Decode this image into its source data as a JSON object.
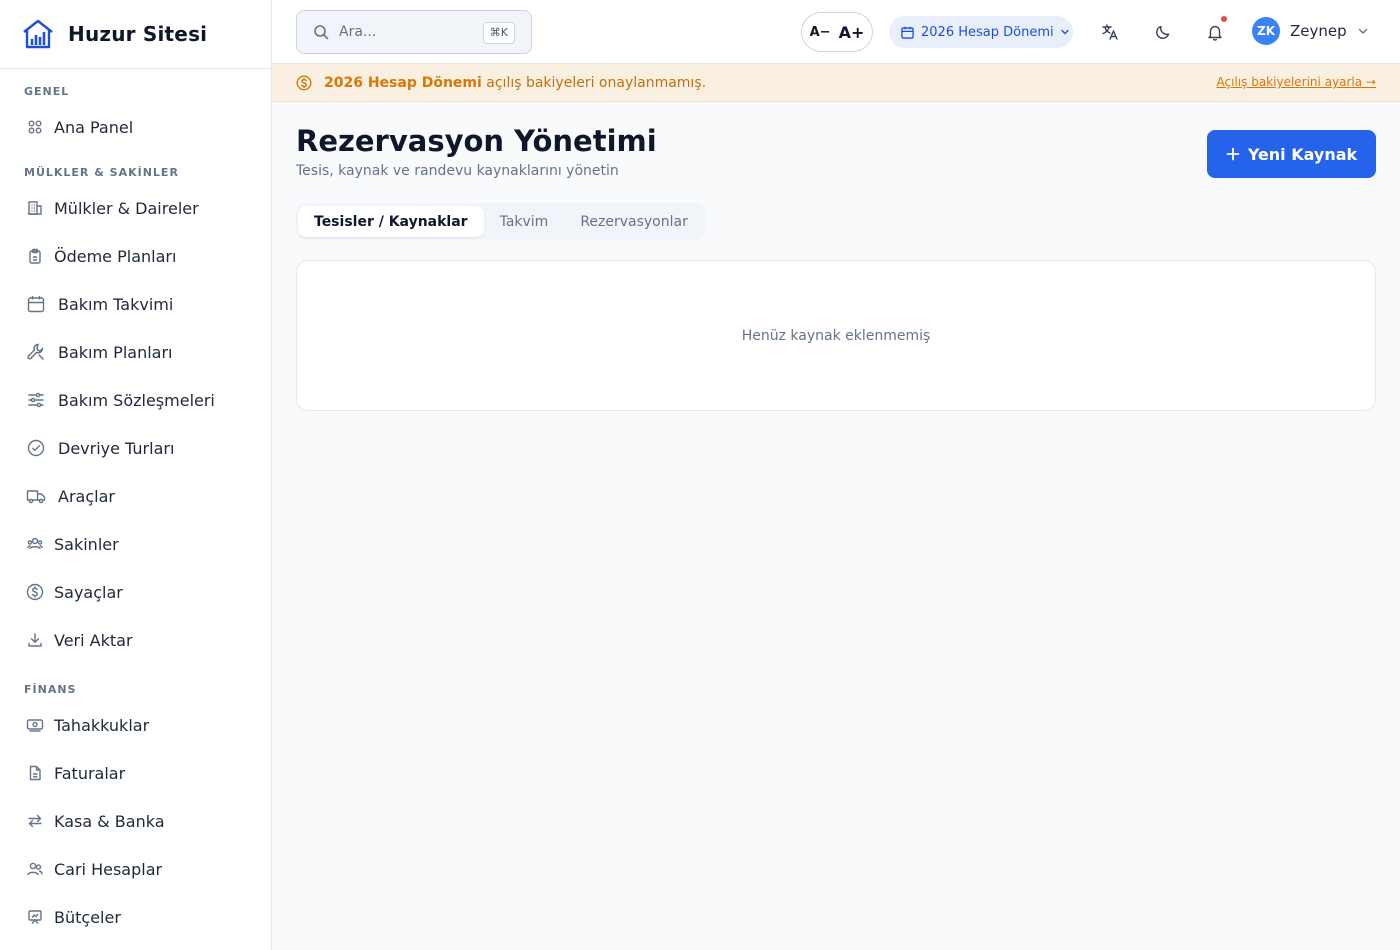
{
  "app": {
    "name": "Huzur Sitesi"
  },
  "sidebar": {
    "sections": [
      {
        "title": "GENEL",
        "items": [
          {
            "label": "Ana Panel",
            "icon": "grid-icon"
          }
        ]
      },
      {
        "title": "MÜLKLER & SAKİNLER",
        "items": [
          {
            "label": "Mülkler & Daireler",
            "icon": "building-icon"
          },
          {
            "label": "Ödeme Planları",
            "icon": "clipboard-icon"
          },
          {
            "label": "Bakım Takvimi",
            "icon": "calendar-icon"
          },
          {
            "label": "Bakım Planları",
            "icon": "wrench-icon"
          },
          {
            "label": "Bakım Sözleşmeleri",
            "icon": "sliders-icon"
          },
          {
            "label": "Devriye Turları",
            "icon": "check-circle-icon"
          },
          {
            "label": "Araçlar",
            "icon": "truck-icon"
          },
          {
            "label": "Sakinler",
            "icon": "users-icon"
          },
          {
            "label": "Sayaçlar",
            "icon": "dollar-circle-icon"
          },
          {
            "label": "Veri Aktar",
            "icon": "download-icon"
          }
        ]
      },
      {
        "title": "FİNANS",
        "items": [
          {
            "label": "Tahakkuklar",
            "icon": "banknote-icon"
          },
          {
            "label": "Faturalar",
            "icon": "file-icon"
          },
          {
            "label": "Kasa & Banka",
            "icon": "arrows-icon"
          },
          {
            "label": "Cari Hesaplar",
            "icon": "people-icon"
          },
          {
            "label": "Bütçeler",
            "icon": "presentation-icon"
          }
        ]
      }
    ]
  },
  "topbar": {
    "search_placeholder": "Ara...",
    "search_shortcut": "⌘K",
    "font_decrease": "A−",
    "font_increase": "A+",
    "period_label": "2026 Hesap Dönemi",
    "user_initials": "ZK",
    "user_name": "Zeynep"
  },
  "banner": {
    "strong": "2026 Hesap Dönemi",
    "text": " açılış bakiyeleri onaylanmamış.",
    "link": "Açılış bakiyelerini ayarla →"
  },
  "main": {
    "title": "Rezervasyon Yönetimi",
    "subtitle": "Tesis, kaynak ve randevu kaynaklarını yönetin",
    "new_button": "Yeni Kaynak",
    "tabs": [
      {
        "label": "Tesisler / Kaynaklar",
        "active": true
      },
      {
        "label": "Takvim",
        "active": false
      },
      {
        "label": "Rezervasyonlar",
        "active": false
      }
    ],
    "empty_message": "Henüz kaynak eklenmemiş"
  },
  "colors": {
    "primary": "#2563eb",
    "banner_bg": "#faf0e2",
    "banner_text": "#d97706",
    "notification_dot": "#ef4444"
  }
}
